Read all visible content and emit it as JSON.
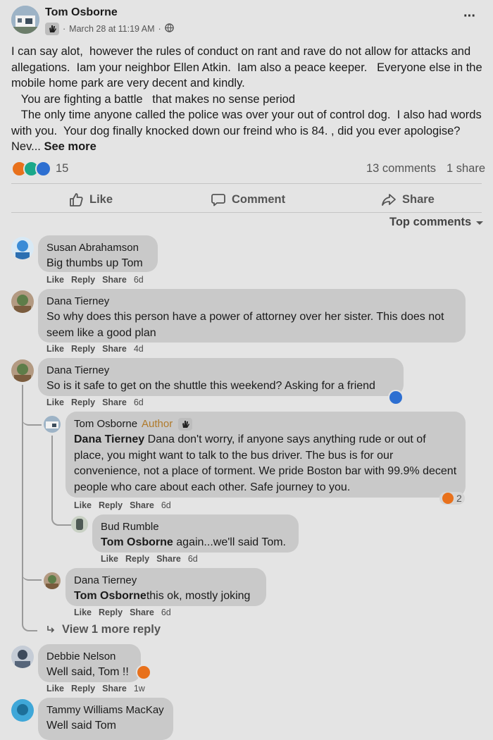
{
  "post": {
    "author": "Tom Osborne",
    "date": "March 28 at 11:19 AM",
    "separator": "·",
    "text": "I can say alot,  however the rules of conduct on rant and rave do not allow for attacks and allegations.  Iam your neighbor Ellen Atkin.  Iam also a peace keeper.   Everyone else in the mobile home park are very decent and kindly.\n   You are fighting a battle   that makes no sense period\n   The only time anyone called the police was over your out of control dog.  I also had words  with you.  Your dog finally knocked down our freind who is 84. , did you ever apologise?  Nev... ",
    "see_more": "See more",
    "reaction_count": "15",
    "comments_count": "13 comments",
    "shares_count": "1 share",
    "more_menu": "···"
  },
  "actions": {
    "like": "Like",
    "comment": "Comment",
    "share": "Share"
  },
  "sort": {
    "label": "Top comments"
  },
  "comment_actions": {
    "like": "Like",
    "reply": "Reply",
    "share": "Share"
  },
  "comments": [
    {
      "name": "Susan Abrahamson",
      "text": "Big thumbs up Tom",
      "time": "6d"
    },
    {
      "name": "Dana Tierney",
      "text": "So why does this person have a power of attorney over her sister. This does not seem like a good plan",
      "time": "4d"
    },
    {
      "name": "Dana Tierney",
      "text": "So is it safe to get on the shuttle this weekend? Asking for a friend",
      "time": "6d"
    },
    {
      "name": "Tom Osborne",
      "badge": "Author",
      "mention": "Dana Tierney",
      "text": " Dana don't worry, if anyone says anything rude or out of place, you might want to talk to the bus driver. The bus is for our convenience, not a place of torment. We pride Boston bar with 99.9% decent people who care about each other. Safe journey to you.",
      "time": "6d",
      "reactions": "2"
    },
    {
      "name": "Bud Rumble",
      "mention": "Tom Osborne",
      "text": " again...we'll said Tom.",
      "time": "6d"
    },
    {
      "name": "Dana Tierney",
      "mention": "Tom Osborne",
      "text": "this ok, mostly joking",
      "time": "6d"
    },
    {
      "name": "Debbie Nelson",
      "text": "Well said, Tom !!",
      "time": "1w"
    },
    {
      "name": "Tammy Williams MacKay",
      "text": "Well said Tom"
    }
  ],
  "view_more": "View 1 more reply",
  "colors": {
    "background": "#e4e4e4",
    "bubble": "#c9c9c9",
    "reaction_orange": "#e8711c",
    "reaction_teal": "#1aa88a",
    "reaction_blue": "#2d6fd1"
  }
}
